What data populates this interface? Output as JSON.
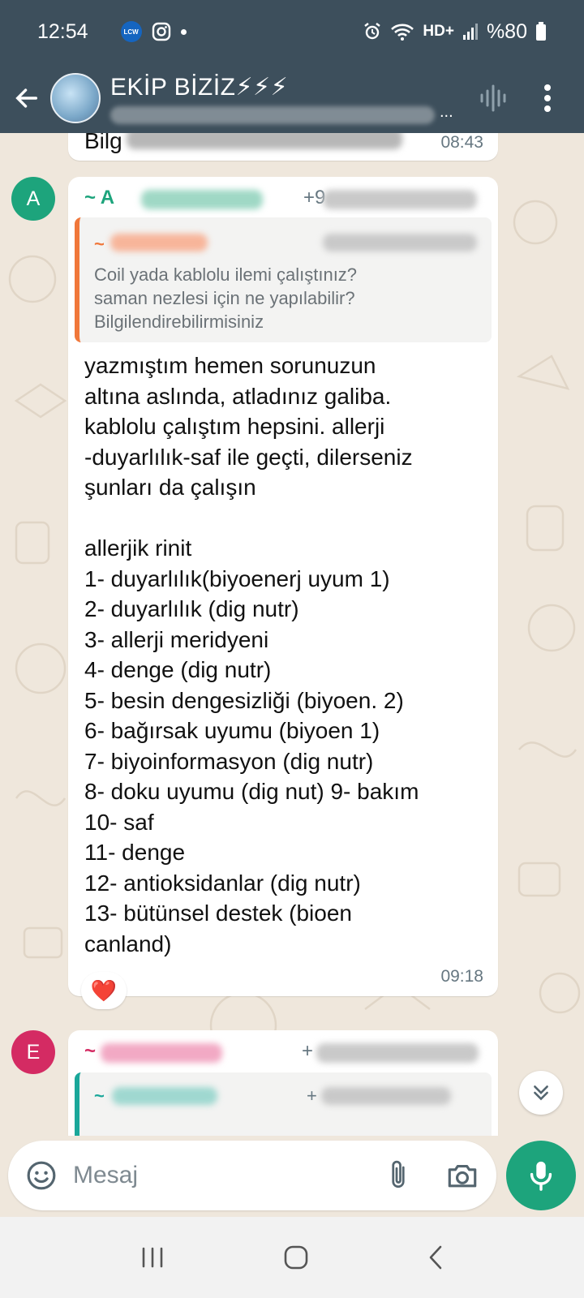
{
  "status_bar": {
    "time": "12:54",
    "left_icons": [
      "lcw-app-icon",
      "instagram-icon",
      "dot"
    ],
    "lcw_label": "LCW",
    "network": "HD+",
    "battery": "%80"
  },
  "header": {
    "title": "EKİP BİZİZ⚡⚡⚡",
    "subtitle_ellipsis": "..."
  },
  "messages": {
    "prev": {
      "snippet": "Bilg",
      "time": "08:43"
    },
    "main": {
      "avatar_letter": "A",
      "sender_prefix": "~ A",
      "phone_prefix": "+9",
      "quote_prefix": "~",
      "quote_text": "Coil yada kablolu ilemi çalıştınız?\nsaman nezlesi için ne yapılabilir?\nBilgilendirebilirmisiniz",
      "body": "yazmıştım hemen sorunuzun\naltına aslında, atladınız galiba.\nkablolu çalıştım hepsini. allerji\n-duyarlılık-saf ile geçti, dilerseniz\nşunları da çalışın\n\nallerjik rinit\n1- duyarlılık(biyoenerj uyum 1)\n2- duyarlılık (dig nutr)\n3- allerji meridyeni\n4- denge (dig nutr)\n5- besin dengesizliği (biyoen. 2)\n6- bağırsak uyumu (biyoen 1)\n7- biyoinformasyon (dig nutr)\n8- doku uyumu (dig nut) 9- bakım\n10- saf\n11- denge\n12- antioksidanlar (dig nutr)\n13- bütünsel destek (bioen\ncanland)",
      "time": "09:18",
      "reaction": "❤️"
    },
    "next": {
      "avatar_letter": "E",
      "sender_prefix": "~",
      "phone_prefix": "+",
      "quote_prefix": "~",
      "quote_phone_prefix": "+"
    }
  },
  "composer": {
    "placeholder": "Mesaj"
  },
  "colors": {
    "header_bg": "#3d4f5c",
    "accent_green": "#1da47c",
    "avatar_a": "#1da47c",
    "avatar_e": "#d42b63",
    "quote_border": "#f0773a",
    "next_quote_border": "#1aa79a",
    "chat_bg": "#efe7dc"
  }
}
